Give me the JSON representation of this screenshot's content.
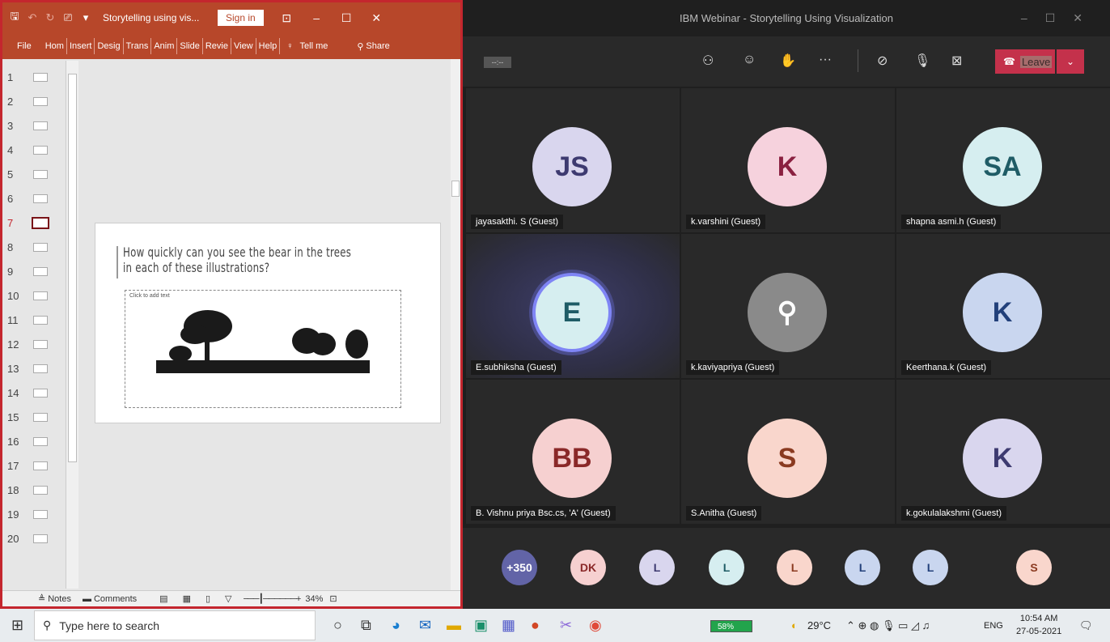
{
  "ppt": {
    "doc_title": "Storytelling using vis...",
    "sign_in": "Sign in",
    "tabs": [
      "File",
      "Hom",
      "Insert",
      "Desig",
      "Trans",
      "Anim",
      "Slide",
      "Revie",
      "View",
      "Help"
    ],
    "tell_me": "Tell me",
    "share": "Share",
    "thumb_numbers": [
      "1",
      "2",
      "3",
      "4",
      "5",
      "6",
      "7",
      "8",
      "9",
      "10",
      "11",
      "12",
      "13",
      "14",
      "15",
      "16",
      "17",
      "18",
      "19",
      "20"
    ],
    "selected_slide": "7",
    "slide_title_line1": "How quickly can you see the bear in the trees",
    "slide_title_line2": "in each of these illustrations?",
    "placeholder_hint": "Click to add text",
    "status_notes": "Notes",
    "status_comments": "Comments",
    "zoom": "34%"
  },
  "teams": {
    "window_title": "IBM Webinar - Storytelling Using Visualization",
    "timer": "--:--",
    "leave_label": "Leave",
    "participants": [
      {
        "initials": "JS",
        "name": "jayasakthi. S (Guest)"
      },
      {
        "initials": "K",
        "name": "k.varshini (Guest)"
      },
      {
        "initials": "SA",
        "name": "shapna asmi.h (Guest)"
      },
      {
        "initials": "E",
        "name": "E.subhiksha (Guest)"
      },
      {
        "initials": "",
        "name": "k.kaviyapriya (Guest)"
      },
      {
        "initials": "K",
        "name": "Keerthana.k (Guest)"
      },
      {
        "initials": "BB",
        "name": "B. Vishnu priya Bsc.cs, 'A' (Guest)"
      },
      {
        "initials": "S",
        "name": "S.Anitha (Guest)"
      },
      {
        "initials": "K",
        "name": "k.gokulalakshmi (Guest)"
      }
    ],
    "strip": [
      "+350",
      "DK",
      "L",
      "L",
      "L",
      "L",
      "L",
      "S"
    ]
  },
  "taskbar": {
    "search_placeholder": "Type here to search",
    "battery": "58%",
    "temperature": "29°C",
    "lang": "ENG",
    "time": "10:54 AM",
    "date": "27-05-2021"
  }
}
